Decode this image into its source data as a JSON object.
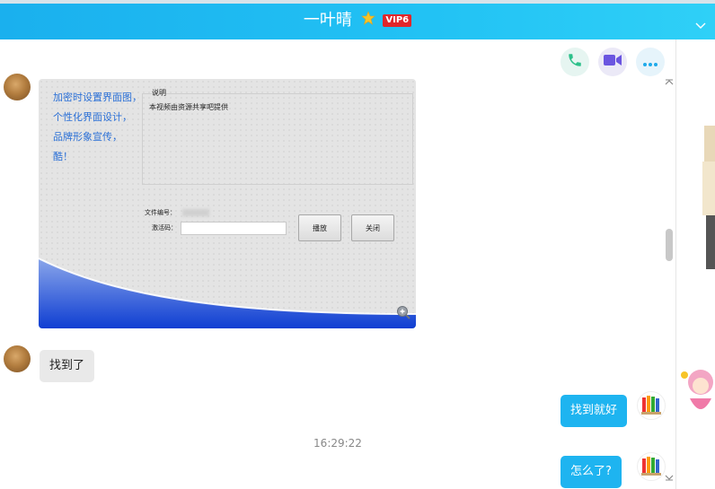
{
  "header": {
    "title": "一叶晴",
    "vip_badge": "VIP6",
    "star_icon": "star-icon",
    "collapse_icon": "chevron-down-icon"
  },
  "actions": {
    "call_icon": "phone-icon",
    "video_icon": "video-camera-icon",
    "more_icon": "more-dots-icon"
  },
  "colors": {
    "header_start": "#1ab0ee",
    "header_end": "#2fd0f7",
    "bubble_self": "#1eb4f0",
    "bubble_other": "#e9e9e9"
  },
  "image_message": {
    "slogan_lines": [
      "加密时设置界面图，",
      "个性化界面设计，",
      "品牌形象宣传，",
      "酷！"
    ],
    "desc_title": "说明",
    "desc_text": "本视频由资源共享吧提供",
    "file_no_label": "文件编号：",
    "code_label": "激活码：",
    "play_button": "播放",
    "close_button": "关闭"
  },
  "messages": [
    {
      "side": "left",
      "text": "找到了"
    },
    {
      "side": "right",
      "text": "找到就好"
    },
    {
      "side": "right",
      "text": "怎么了?"
    }
  ],
  "timestamp": "16:29:22"
}
